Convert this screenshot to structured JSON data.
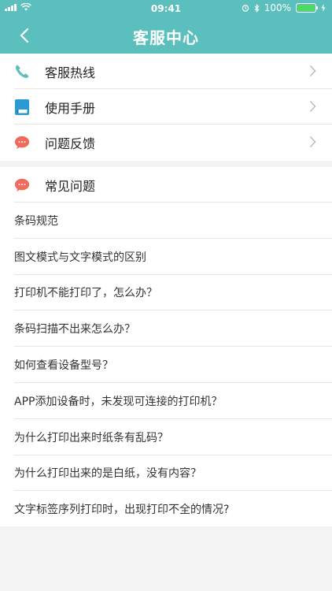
{
  "status_bar": {
    "time": "09:41",
    "battery_text": "100%"
  },
  "header": {
    "title": "客服中心",
    "back_icon": "chevron-left-icon"
  },
  "menu": [
    {
      "label": "客服热线",
      "icon": "phone-icon",
      "color": "#5bbfbe"
    },
    {
      "label": "使用手册",
      "icon": "book-icon",
      "color": "#2a9ad6"
    },
    {
      "label": "问题反馈",
      "icon": "chat-bubble-icon",
      "color": "#f16a5a"
    }
  ],
  "faq": {
    "title": "常见问题",
    "items": [
      "条码规范",
      "图文模式与文字模式的区别",
      "打印机不能打印了，怎么办？",
      "条码扫描不出来怎么办？",
      "如何查看设备型号？",
      "APP添加设备时，未发现可连接的打印机？",
      "为什么打印出来时纸条有乱码？",
      "为什么打印出来的是白纸，没有内容？",
      "文字标签序列打印时，出现打印不全的情况?"
    ]
  },
  "colors": {
    "brand": "#5bbfbe",
    "battery": "#4cd964"
  }
}
